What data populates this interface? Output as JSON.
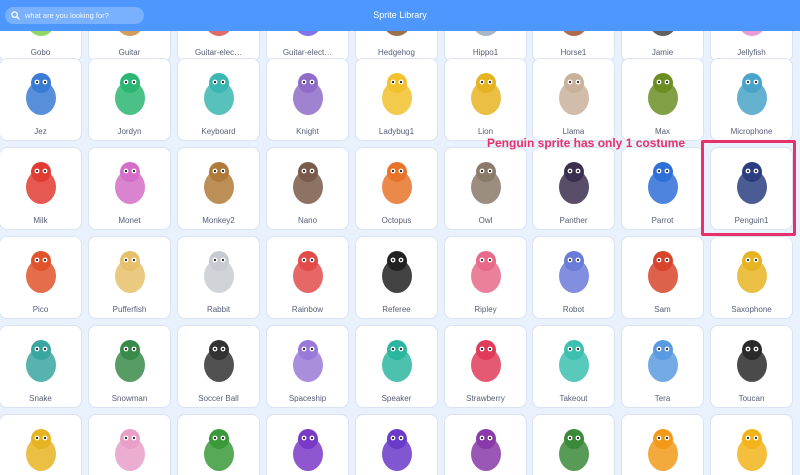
{
  "header": {
    "title": "Sprite Library",
    "search_placeholder": "what are you looking for?"
  },
  "colors": {
    "header_bg": "#4d97ff",
    "page_bg": "#e9f1fc",
    "annotation": "#e8306b"
  },
  "annotation": {
    "text": "Penguin sprite has only 1 costume"
  },
  "sprites": [
    {
      "name": "Gobo",
      "icon": "gobo-icon",
      "color": "#7ad04a"
    },
    {
      "name": "Guitar",
      "icon": "guitar-icon",
      "color": "#c98b3f"
    },
    {
      "name": "Guitar-elec…",
      "icon": "electric-guitar-icon",
      "color": "#d9534f"
    },
    {
      "name": "Guitar-elect…",
      "icon": "electric-guitar-2-icon",
      "color": "#6c5ce7"
    },
    {
      "name": "Hedgehog",
      "icon": "hedgehog-icon",
      "color": "#8b5a2b"
    },
    {
      "name": "Hippo1",
      "icon": "hippo-icon",
      "color": "#9ab"
    },
    {
      "name": "Horse1",
      "icon": "horse-icon",
      "color": "#a0522d"
    },
    {
      "name": "Jamie",
      "icon": "jamie-icon",
      "color": "#444"
    },
    {
      "name": "Jellyfish",
      "icon": "jellyfish-icon",
      "color": "#e48ad0"
    },
    {
      "name": "Jez",
      "icon": "jez-icon",
      "color": "#3a7bd5"
    },
    {
      "name": "Jordyn",
      "icon": "jordyn-icon",
      "color": "#2bb673"
    },
    {
      "name": "Keyboard",
      "icon": "keyboard-icon",
      "color": "#3cb6b0"
    },
    {
      "name": "Knight",
      "icon": "knight-icon",
      "color": "#8e6cc8"
    },
    {
      "name": "Ladybug1",
      "icon": "ladybug-icon",
      "color": "#f2c12e"
    },
    {
      "name": "Lion",
      "icon": "lion-icon",
      "color": "#e6b422"
    },
    {
      "name": "Llama",
      "icon": "llama-icon",
      "color": "#c9b29b"
    },
    {
      "name": "Max",
      "icon": "max-icon",
      "color": "#6b8e23"
    },
    {
      "name": "Microphone",
      "icon": "microphone-icon",
      "color": "#4aa3c8"
    },
    {
      "name": "Milk",
      "icon": "milk-icon",
      "color": "#e03c31"
    },
    {
      "name": "Monet",
      "icon": "monet-icon",
      "color": "#d46ec8"
    },
    {
      "name": "Monkey2",
      "icon": "monkey-icon",
      "color": "#b07b3a"
    },
    {
      "name": "Nano",
      "icon": "nano-icon",
      "color": "#7a5a4a"
    },
    {
      "name": "Octopus",
      "icon": "octopus-icon",
      "color": "#e8742c"
    },
    {
      "name": "Owl",
      "icon": "owl-icon",
      "color": "#8a7a6a"
    },
    {
      "name": "Panther",
      "icon": "panther-icon",
      "color": "#3b2f4f"
    },
    {
      "name": "Parrot",
      "icon": "parrot-icon",
      "color": "#2f6fd8"
    },
    {
      "name": "Penguin1",
      "icon": "penguin-icon",
      "color": "#2c3e80"
    },
    {
      "name": "Pico",
      "icon": "pico-icon",
      "color": "#e0542b"
    },
    {
      "name": "Pufferfish",
      "icon": "pufferfish-icon",
      "color": "#e6c06a"
    },
    {
      "name": "Rabbit",
      "icon": "rabbit-icon",
      "color": "#c8ccd2"
    },
    {
      "name": "Rainbow",
      "icon": "rainbow-icon",
      "color": "#e34b4b"
    },
    {
      "name": "Referee",
      "icon": "referee-icon",
      "color": "#222"
    },
    {
      "name": "Ripley",
      "icon": "ripley-icon",
      "color": "#e86a8a"
    },
    {
      "name": "Robot",
      "icon": "robot-icon",
      "color": "#6b7bd8"
    },
    {
      "name": "Sam",
      "icon": "sam-icon",
      "color": "#d8452b"
    },
    {
      "name": "Saxophone",
      "icon": "saxophone-icon",
      "color": "#e6b422"
    },
    {
      "name": "Snake",
      "icon": "snake-icon",
      "color": "#3aa6a0"
    },
    {
      "name": "Snowman",
      "icon": "snowman-icon",
      "color": "#3a8a4a"
    },
    {
      "name": "Soccer Ball",
      "icon": "soccer-ball-icon",
      "color": "#333"
    },
    {
      "name": "Spaceship",
      "icon": "spaceship-icon",
      "color": "#9a7ad8"
    },
    {
      "name": "Speaker",
      "icon": "speaker-icon",
      "color": "#2bb6a0"
    },
    {
      "name": "Strawberry",
      "icon": "strawberry-icon",
      "color": "#e03c5a"
    },
    {
      "name": "Takeout",
      "icon": "takeout-icon",
      "color": "#3cc0b0"
    },
    {
      "name": "Tera",
      "icon": "tera-icon",
      "color": "#5a9ae0"
    },
    {
      "name": "Toucan",
      "icon": "toucan-icon",
      "color": "#2a2a2a"
    },
    {
      "name": "",
      "icon": "trumpet-icon",
      "color": "#e6b422"
    },
    {
      "name": "",
      "icon": "unicorn-icon",
      "color": "#e8a0c8"
    },
    {
      "name": "",
      "icon": "watermelon-icon",
      "color": "#3a9a3a"
    },
    {
      "name": "",
      "icon": "witch-icon",
      "color": "#7a3ac8"
    },
    {
      "name": "",
      "icon": "wizard-icon",
      "color": "#6a3ac8"
    },
    {
      "name": "",
      "icon": "wizard-girl-icon",
      "color": "#8a3aa8"
    },
    {
      "name": "",
      "icon": "wizard-toad-icon",
      "color": "#3a8a3a"
    },
    {
      "name": "",
      "icon": "letter-a-icon",
      "color": "#f29a1a"
    },
    {
      "name": "",
      "icon": "letter-b-icon",
      "color": "#f2b41a"
    }
  ]
}
